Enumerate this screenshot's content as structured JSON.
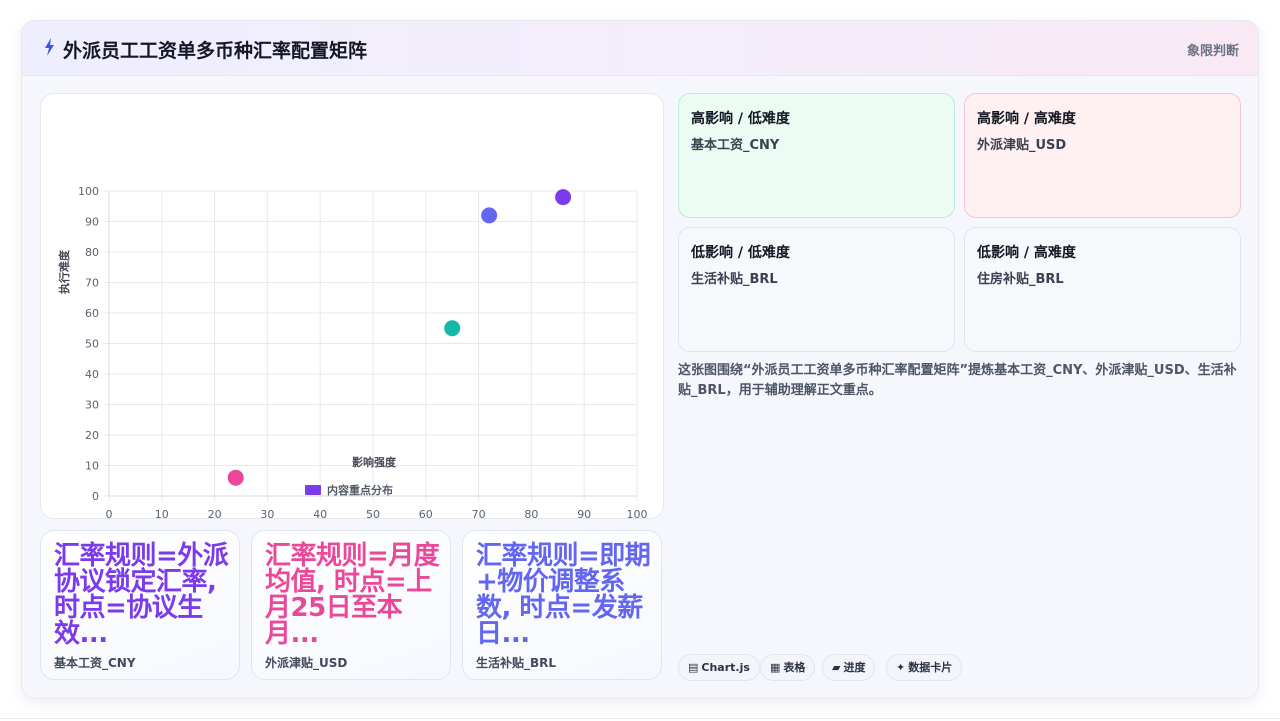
{
  "header": {
    "title": "外派员工工资单多币种汇率配置矩阵",
    "tag": "象限判断"
  },
  "chart_data": {
    "type": "scatter",
    "xlabel": "影响强度",
    "ylabel": "执行难度",
    "xlim": [
      0,
      100
    ],
    "ylim": [
      0,
      100
    ],
    "xticks": [
      0,
      10,
      20,
      30,
      40,
      50,
      60,
      70,
      80,
      90,
      100
    ],
    "yticks": [
      0,
      10,
      20,
      30,
      40,
      50,
      60,
      70,
      80,
      90,
      100
    ],
    "grid": true,
    "legend_position": "bottom",
    "series": [
      {
        "name": "内容重点分布",
        "legend_color": "#7c3aed",
        "points": [
          {
            "x": 86,
            "y": 98,
            "color": "#7c3aed"
          },
          {
            "x": 72,
            "y": 92,
            "color": "#6366f1"
          },
          {
            "x": 65,
            "y": 55,
            "color": "#14b8a6"
          },
          {
            "x": 24,
            "y": 6,
            "color": "#ec4899"
          }
        ]
      }
    ]
  },
  "stats": [
    {
      "value": "汇率规则=外派协议锁定汇率, 时点=协议生效...",
      "label": "基本工资_CNY",
      "color": "#7c3aed"
    },
    {
      "value": "汇率规则=月度均值, 时点=上月25日至本月...",
      "label": "外派津贴_USD",
      "color": "#ec4899"
    },
    {
      "value": "汇率规则=即期+物价调整系数, 时点=发薪日...",
      "label": "生活补贴_BRL",
      "color": "#6366f1"
    }
  ],
  "quadrants": [
    {
      "title": "高影响 / 低难度",
      "item": "基本工资_CNY",
      "bg": "#eafcf3",
      "border": "#b9eed4"
    },
    {
      "title": "高影响 / 高难度",
      "item": "外派津贴_USD",
      "bg": "#fff0f2",
      "border": "#f7c5cf"
    },
    {
      "title": "低影响 / 低难度",
      "item": "生活补贴_BRL",
      "bg": "#f7f8fc",
      "border": "#dfe4ee"
    },
    {
      "title": "低影响 / 高难度",
      "item": "住房补贴_BRL",
      "bg": "#f7f8fc",
      "border": "#dfe4ee"
    }
  ],
  "description": "这张图围绕“外派员工工资单多币种汇率配置矩阵”提炼基本工资_CNY、外派津贴_USD、生活补贴_BRL，用于辅助理解正文重点。",
  "chips": [
    {
      "icon": "▤",
      "label": "Chart.js"
    },
    {
      "icon": "▦",
      "label": "表格"
    },
    {
      "icon": "▰",
      "label": "进度"
    },
    {
      "icon": "✦",
      "label": "数据卡片"
    }
  ]
}
